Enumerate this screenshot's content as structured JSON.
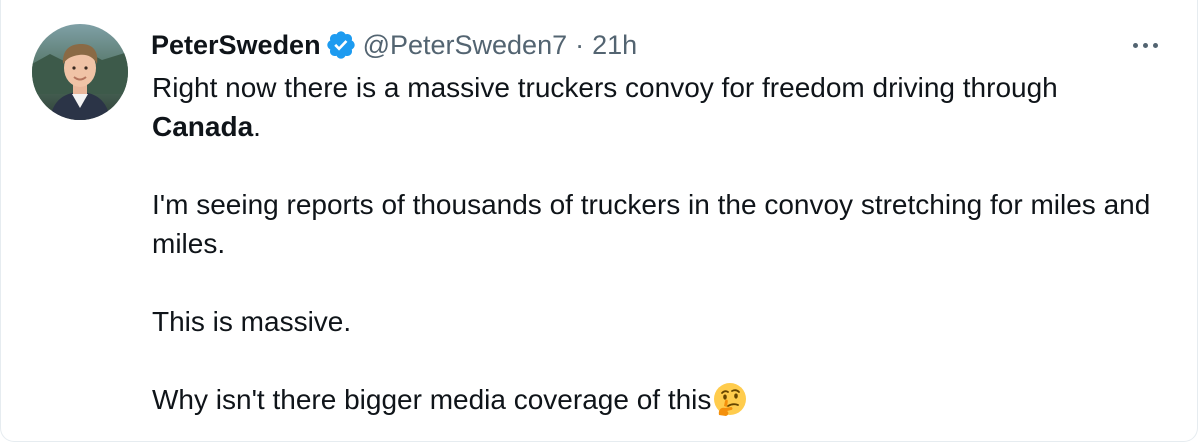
{
  "tweet": {
    "display_name": "PeterSweden",
    "handle": "@PeterSweden7",
    "separator": "·",
    "time": "21h",
    "more_icon": "more-horizontal-icon",
    "verified_icon": "verified-badge-icon",
    "avatar_icon": "avatar",
    "text": {
      "p1_before": "Right now there is a massive truckers convoy for freedom driving through",
      "p1_bold": "Canada",
      "p1_after": ".",
      "p2": "I'm seeing reports of thousands of truckers in the convoy stretching for miles and miles.",
      "p3": "This is massive.",
      "p4": "Why isn't there bigger media coverage of this",
      "p4_emoji": "thinking-face-emoji"
    },
    "colors": {
      "text": "#0f1419",
      "secondary": "#536471",
      "verified": "#1d9bf0"
    }
  }
}
